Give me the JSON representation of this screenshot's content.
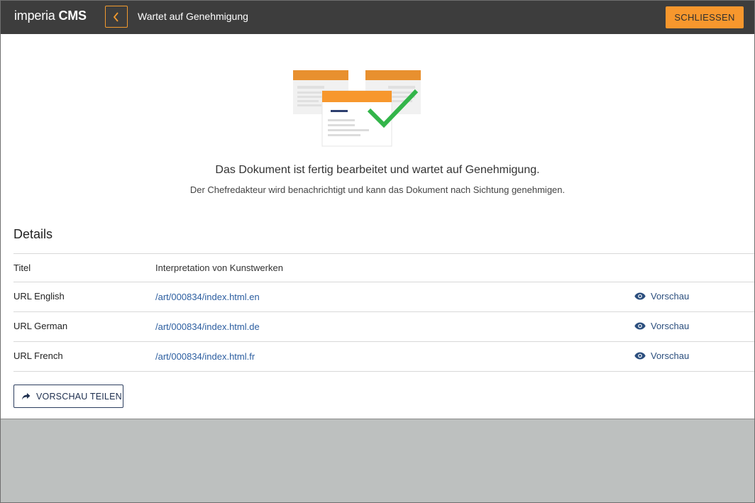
{
  "header": {
    "logo_part1": "imperia",
    "logo_part2": "CMS",
    "title": "Wartet auf Genehmigung",
    "close_label": "SCHLIESSEN"
  },
  "message": {
    "main": "Das Dokument ist fertig bearbeitet und wartet auf Genehmigung.",
    "sub": "Der Chefredakteur wird benachrichtigt und kann das Dokument nach Sichtung genehmigen."
  },
  "details": {
    "heading": "Details",
    "rows": [
      {
        "label": "Titel",
        "value": "Interpretation von Kunstwerken"
      },
      {
        "label": "URL English",
        "value": "/art/000834/index.html.en",
        "preview": "Vorschau"
      },
      {
        "label": "URL German",
        "value": "/art/000834/index.html.de",
        "preview": "Vorschau"
      },
      {
        "label": "URL French",
        "value": "/art/000834/index.html.fr",
        "preview": "Vorschau"
      }
    ]
  },
  "share_label": "VORSCHAU TEILEN",
  "colors": {
    "topbar": "#3d3d3d",
    "accent_orange": "#f7972d",
    "link_blue": "#2c5ea0",
    "check_green": "#33b54a"
  },
  "icons": [
    "chevron-left-icon",
    "document-approved-illustration",
    "eye-icon",
    "share-arrow-icon"
  ]
}
